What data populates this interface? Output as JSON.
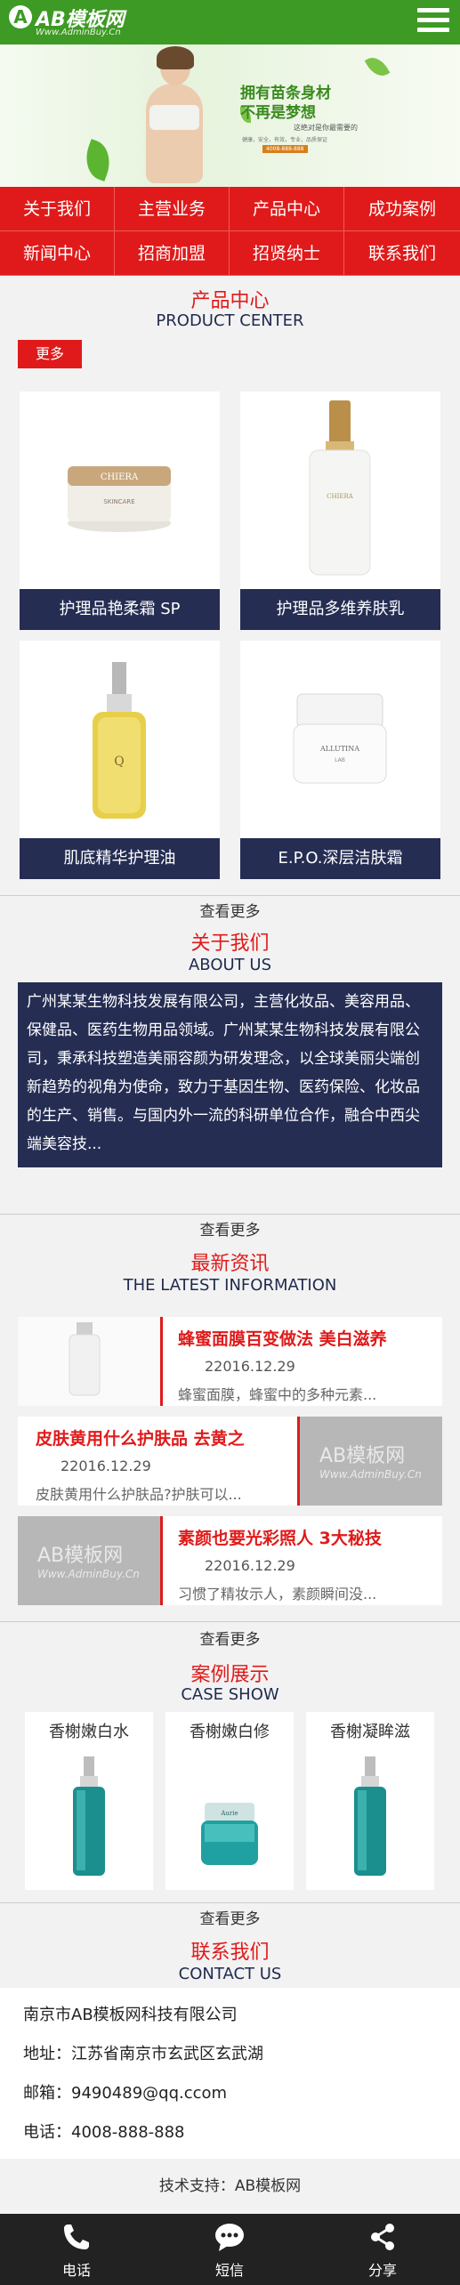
{
  "header": {
    "logo_mark": "A",
    "logo_text": "AB模板网",
    "logo_sub": "Www.AdminBuy.Cn",
    "menu_icon": "hamburger-menu-icon",
    "brand_color": "#3d9a24"
  },
  "banner": {
    "line1": "拥有苗条身材",
    "line2": "不再是梦想",
    "line3": "这绝对是你最需要的",
    "line4": "健康，安全，有效，专业，品质保证",
    "phone": "4008-888-888"
  },
  "nav": {
    "items": [
      {
        "label": "关于我们"
      },
      {
        "label": "主营业务"
      },
      {
        "label": "产品中心"
      },
      {
        "label": "成功案例"
      },
      {
        "label": "新闻中心"
      },
      {
        "label": "招商加盟"
      },
      {
        "label": "招贤纳士"
      },
      {
        "label": "联系我们"
      }
    ],
    "color": "#e01a1a"
  },
  "products": {
    "title": "产品中心",
    "subtitle": "PRODUCT CENTER",
    "more_label": "更多",
    "items": [
      {
        "label": "护理品艳柔霜 SP"
      },
      {
        "label": "护理品多维养肤乳"
      },
      {
        "label": "肌底精华护理油"
      },
      {
        "label": "E.P.O.深层洁肤霜"
      }
    ],
    "view_more": "查看更多"
  },
  "about": {
    "title": "关于我们",
    "subtitle": "ABOUT US",
    "text": "广州某某生物科技发展有限公司，主营化妆品、美容用品、保健品、医药生物用品领域。广州某某生物科技发展有限公司，秉承科技塑造美丽容颜为研发理念，以全球美丽尖端创新趋势的视角为使命，致力于基因生物、医药保险、化妆品的生产、销售。与国内外一流的科研单位合作，融合中西尖端美容技...",
    "view_more": "查看更多"
  },
  "news": {
    "title": "最新资讯",
    "subtitle": "THE LATEST INFORMATION",
    "items": [
      {
        "title": "蜂蜜面膜百变做法 美白滋养",
        "date": "22016.12.29",
        "desc": "蜂蜜面膜，蜂蜜中的多种元素..."
      },
      {
        "title": "皮肤黄用什么护肤品 去黄之",
        "date": "22016.12.29",
        "desc": "皮肤黄用什么护肤品?护肤可以..."
      },
      {
        "title": "素颜也要光彩照人 3大秘技",
        "date": "22016.12.29",
        "desc": "习惯了精妆示人，素颜瞬间没..."
      }
    ],
    "watermark_main": "AB模板网",
    "watermark_sub": "Www.AdminBuy.Cn",
    "view_more": "查看更多"
  },
  "cases": {
    "title": "案例展示",
    "subtitle": "CASE SHOW",
    "items": [
      {
        "label": "香榭嫩白水"
      },
      {
        "label": "香榭嫩白修"
      },
      {
        "label": "香榭凝眸滋"
      }
    ],
    "view_more": "查看更多"
  },
  "contact": {
    "title": "联系我们",
    "subtitle": "CONTACT US",
    "company": "南京市AB模板网科技有限公司",
    "address": "地址：江苏省南京市玄武区玄武湖",
    "email": "邮箱：9490489@qq.ccom",
    "phone": "电话：4008-888-888"
  },
  "support": "技术支持：AB模板网",
  "footer": {
    "items": [
      {
        "label": "电话",
        "icon": "phone-icon"
      },
      {
        "label": "短信",
        "icon": "message-icon"
      },
      {
        "label": "分享",
        "icon": "share-icon"
      }
    ]
  }
}
